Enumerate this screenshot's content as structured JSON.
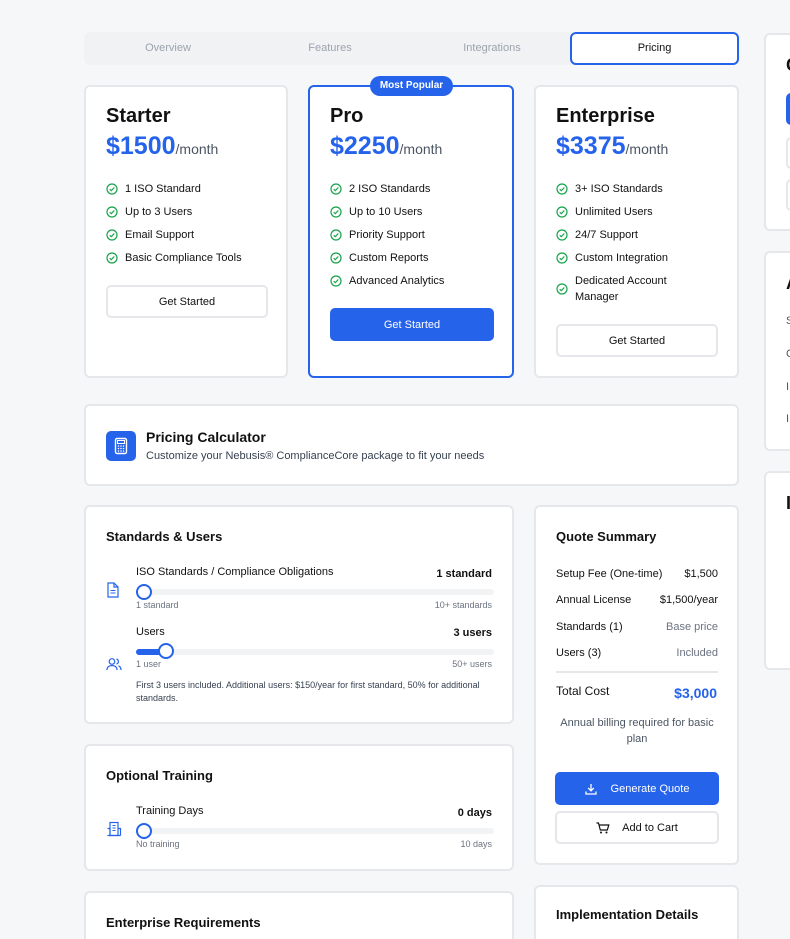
{
  "tabs": [
    {
      "label": "Overview"
    },
    {
      "label": "Features"
    },
    {
      "label": "Integrations"
    },
    {
      "label": "Pricing",
      "active": true
    }
  ],
  "plans": [
    {
      "name": "Starter",
      "price": "$1500",
      "per": "/month",
      "features": [
        "1 ISO Standard",
        "Up to 3 Users",
        "Email Support",
        "Basic Compliance Tools"
      ],
      "cta": "Get Started"
    },
    {
      "name": "Pro",
      "price": "$2250",
      "per": "/month",
      "badge": "Most Popular",
      "features": [
        "2 ISO Standards",
        "Up to 10 Users",
        "Priority Support",
        "Custom Reports",
        "Advanced Analytics"
      ],
      "cta": "Get Started"
    },
    {
      "name": "Enterprise",
      "price": "$3375",
      "per": "/month",
      "features": [
        "3+ ISO Standards",
        "Unlimited Users",
        "24/7 Support",
        "Custom Integration",
        "Dedicated Account Manager"
      ],
      "cta": "Get Started"
    }
  ],
  "calculator": {
    "title": "Pricing Calculator",
    "subtitle": "Customize your Nebusis® ComplianceCore package to fit your needs"
  },
  "standards_users": {
    "title": "Standards & Users",
    "standards": {
      "label": "ISO Standards / Compliance Obligations",
      "value": "1 standard",
      "min": "1 standard",
      "max": "10+ standards",
      "level": 0
    },
    "users": {
      "label": "Users",
      "value": "3 users",
      "min": "1 user",
      "max": "50+ users",
      "level": 0.0638
    },
    "note": "First 3 users included. Additional users: $150/year for first standard, 50% for additional standards."
  },
  "training": {
    "title": "Optional Training",
    "label": "Training Days",
    "value": "0 days",
    "min": "No training",
    "max": "10 days",
    "level": 0
  },
  "enterprise": {
    "title": "Enterprise Requirements"
  },
  "quote": {
    "title": "Quote Summary",
    "rows": [
      {
        "k": "Setup Fee (One-time)",
        "v": "$1,500"
      },
      {
        "k": "Annual License",
        "v": "$1,500/year"
      },
      {
        "k": "Standards (1)",
        "v": "Base price"
      },
      {
        "k": "Users (3)",
        "v": "Included"
      }
    ],
    "total_label": "Total Cost",
    "total_value": "$3,000",
    "billing_note": "Annual billing required for basic plan",
    "generate": "Generate Quote",
    "cart": "Add to Cart"
  },
  "implementation": {
    "title": "Implementation Details"
  },
  "colors": {
    "accent": "#2563eb",
    "check": "#16a34a",
    "border": "#e5e7eb",
    "bg": "#f6f7f9"
  }
}
